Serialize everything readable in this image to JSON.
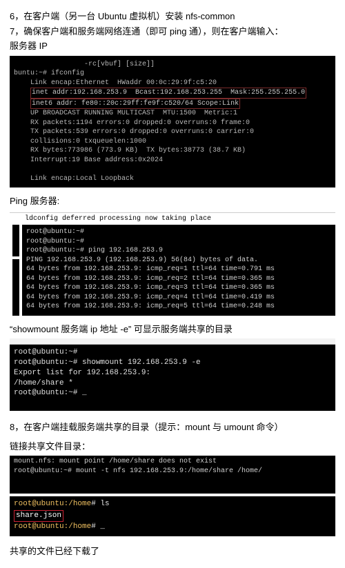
{
  "step6": "6，在客户端（另一台 Ubuntu 虚拟机）安装 nfs-common",
  "step7": "7，确保客户端和服务端网络连通（即可 ping 通），则在客户端输入：",
  "server_ip_label": "服务器 IP",
  "ifconfig": {
    "l0": "                 -rc[vbuf] [size]]",
    "l1": "buntu:~# ifconfig",
    "l2": "    Link encap:Ethernet  HWaddr 00:0c:29:9f:c5:20",
    "hl1": "inet addr:192.168.253.9  Bcast:192.168.253.255  Mask:255.255.255.0",
    "hl2": "inet6 addr: fe80::20c:29ff:fe9f:c520/64 Scope:Link",
    "l5": "    UP BROADCAST RUNNING MULTICAST  MTU:1500  Metric:1",
    "l6": "    RX packets:1194 errors:0 dropped:0 overruns:0 frame:0",
    "l7": "    TX packets:539 errors:0 dropped:0 overruns:0 carrier:0",
    "l8": "    collisions:0 txqueuelen:1000",
    "l9": "    RX bytes:773986 (773.9 KB)  TX bytes:38773 (38.7 KB)",
    "l10": "    Interrupt:19 Base address:0x2024",
    "l11": "",
    "l12": "    Link encap:Local Loopback"
  },
  "ping_label": "Ping  服务器:",
  "ping_top": "ldconfig deferred processing now taking place",
  "ping": {
    "p1": "root@ubuntu:~#",
    "p2": "root@ubuntu:~#",
    "p3": "root@ubuntu:~# ping 192.168.253.9",
    "p4": "PING 192.168.253.9 (192.168.253.9) 56(84) bytes of data.",
    "p5": "64 bytes from 192.168.253.9: icmp_req=1 ttl=64 time=0.791 ms",
    "p6": "64 bytes from 192.168.253.9: icmp_req=2 ttl=64 time=0.365 ms",
    "p7": "64 bytes from 192.168.253.9: icmp_req=3 ttl=64 time=0.365 ms",
    "p8": "64 bytes from 192.168.253.9: icmp_req=4 ttl=64 time=0.419 ms",
    "p9": "64 bytes from 192.168.253.9: icmp_req=5 ttl=64 time=0.248 ms"
  },
  "showmount_label": "“showmount 服务端 ip 地址  -e”  可显示服务端共享的目录",
  "showmount": {
    "s1": "root@ubuntu:~#",
    "s2": "root@ubuntu:~# showmount 192.168.253.9 -e",
    "s3": "Export list for 192.168.253.9:",
    "s4": "/home/share *",
    "s5": "root@ubuntu:~# _"
  },
  "step8": "8，在客户端挂载服务端共享的目录（提示：mount 与 umount 命令）",
  "link_label": "链接共享文件目录：",
  "mount": {
    "m1": "mount.nfs: mount point /home/share does not exist",
    "m2": "root@ubuntu:~# mount -t nfs 192.168.253.9:/home/share /home/"
  },
  "ls": {
    "u1": "root@ubuntu",
    "path1": ":/home",
    "cmd1": "# ls",
    "file": "share.json",
    "u2": "root@ubuntu",
    "path2": ":/home",
    "cmd2": "# _"
  },
  "done_label": "共享的文件已经下载了"
}
